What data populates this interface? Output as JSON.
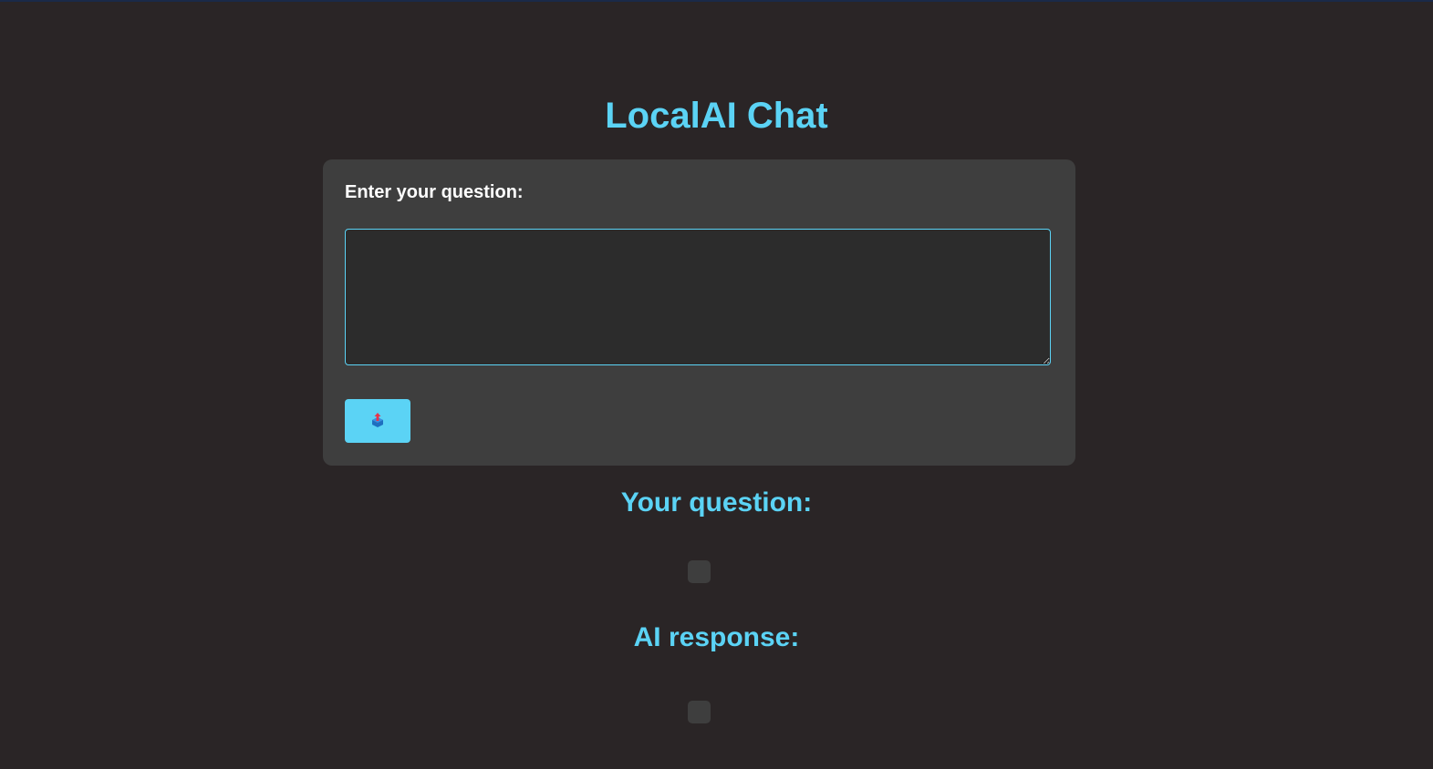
{
  "page": {
    "title": "LocalAI Chat"
  },
  "form": {
    "question_label": "Enter your question:",
    "question_value": "",
    "question_placeholder": "",
    "submit_icon": "outbox-tray-icon"
  },
  "results": {
    "question_heading": "Your question:",
    "question_text": "",
    "response_heading": "AI response:",
    "response_text": ""
  },
  "colors": {
    "accent": "#5bd3f5",
    "background": "#2a2526",
    "card": "#3e3e3e",
    "input_background": "#2c2c2c"
  }
}
